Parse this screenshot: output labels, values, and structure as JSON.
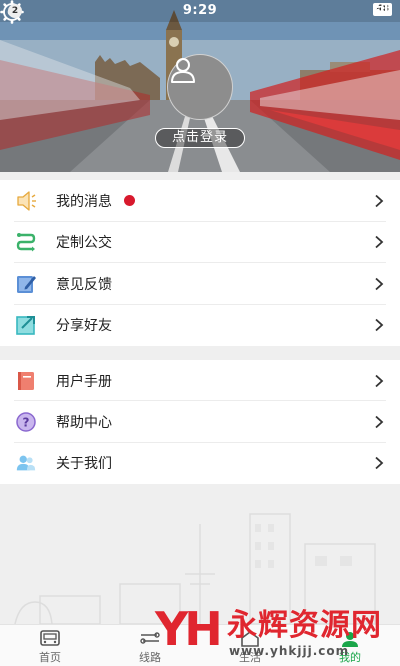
{
  "status_bar": {
    "notification_count": "2",
    "time": "9:29",
    "battery": "48"
  },
  "header": {
    "login_label": "点击登录",
    "settings_icon": "gear-icon"
  },
  "menu_primary": [
    {
      "label": "我的消息",
      "icon": "speaker-icon",
      "has_unread": true
    },
    {
      "label": "定制公交",
      "icon": "route-icon"
    },
    {
      "label": "意见反馈",
      "icon": "feedback-icon"
    },
    {
      "label": "分享好友",
      "icon": "share-icon"
    }
  ],
  "menu_secondary": [
    {
      "label": "用户手册",
      "icon": "manual-icon"
    },
    {
      "label": "帮助中心",
      "icon": "help-icon"
    },
    {
      "label": "关于我们",
      "icon": "about-users-icon"
    }
  ],
  "tabs": [
    {
      "label": "首页",
      "icon": "bus-icon"
    },
    {
      "label": "线路",
      "icon": "route-line-icon"
    },
    {
      "label": "生活",
      "icon": "life-icon"
    },
    {
      "label": "我的",
      "icon": "profile-icon",
      "active": true
    }
  ],
  "watermark": {
    "logo_text": "YH",
    "name": "永辉资源网",
    "url": "www.yhkjjj.com"
  },
  "colors": {
    "accent_green": "#1aa64a",
    "unread_red": "#d8192d",
    "watermark_red": "#e0262f"
  }
}
